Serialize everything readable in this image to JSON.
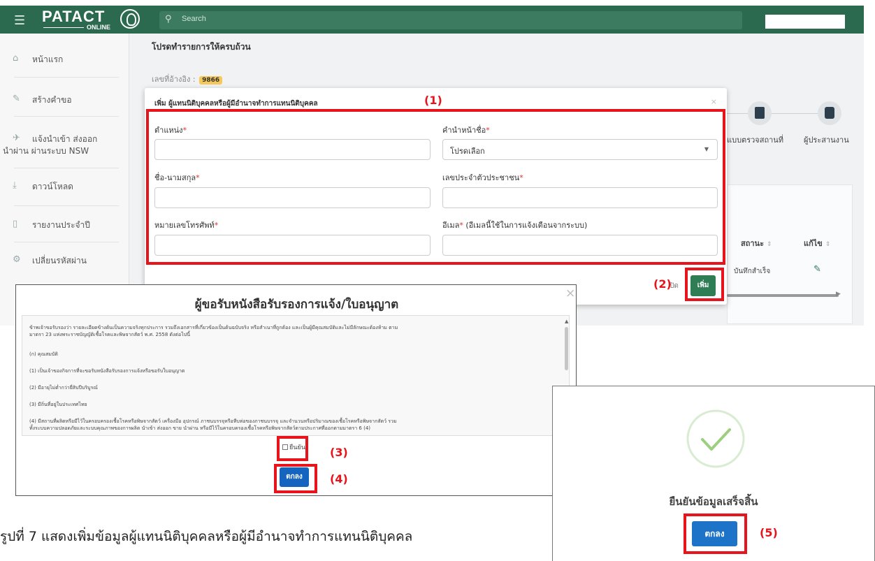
{
  "app": {
    "logo_text": "PATACT",
    "logo_sub": "ONLINE",
    "search_placeholder": "Search"
  },
  "sidebar": {
    "items": [
      {
        "label": "หน้าแรก"
      },
      {
        "label": "สร้างคำขอ"
      },
      {
        "label": "แจ้งนำเข้า ส่งออก"
      },
      {
        "label": "นำผ่าน ผ่านระบบ NSW"
      },
      {
        "label": "ดาวน์โหลด"
      },
      {
        "label": "รายงานประจำปี"
      },
      {
        "label": "เปลี่ยนรหัสผ่าน"
      }
    ]
  },
  "content": {
    "title": "โปรดทำรายการให้ครบถ้วน",
    "ref_label": "เลขที่อ้างอิง :",
    "ref_no": "9866",
    "steps": [
      "แบบตรวจสถานที่",
      "ผู้ประสานงาน"
    ],
    "table_headers": [
      "สถานะ",
      "แก้ไข"
    ],
    "row_status": "บันทึกสำเร็จ"
  },
  "modal1": {
    "title": "เพิ่ม ผู้แทนนิติบุคคลหรือผู้มีอำนาจทำการแทนนิติบุคคล",
    "close": "×",
    "fields": {
      "position": "ตำแหน่ง",
      "prefix": "คำนำหน้าชื่อ",
      "prefix_value": "โปรดเลือก",
      "fullname": "ชื่อ-นามสกุล",
      "id_card": "เลขประจำตัวประชาชน",
      "phone": "หมายเลขโทรศัพท์",
      "email": "อีเมล",
      "email_note": " (อีเมลนี้ใช้ในการแจ้งเตือนจากระบบ)",
      "required_mark": "*"
    },
    "close_button": "ปิด",
    "add_button": "เพิ่ม"
  },
  "dialog2": {
    "title": "ผู้ขอรับหนังสือรับรองการแจ้ง/ใบอนุญาต",
    "close": "×",
    "paragraphs": [
      "ข้าพเจ้าขอรับรองว่า รายละเอียดข้างต้นเป็นความจริงทุกประการ รวมถึงเอกสารที่เกี่ยวข้องเป็นต้นฉบับจริง หรือสำเนาที่ถูกต้อง และเป็นผู้มีคุณสมบัติและไม่มีลักษณะต้องห้าม ตาม",
      "มาตรา 23 แห่งพระราชบัญญัติเชื้อโรคและพิษจากสัตว์ พ.ศ. 2558 ดังต่อไปนี้",
      "(ก) คุณสมบัติ",
      "(1) เป็นเจ้าของกิจการที่จะขอรับหนังสือรับรองการแจ้งหรือขอรับใบอนุญาต",
      "(2) มีอายุไม่ต่ำกว่ายี่สิบปีบริบูรณ์",
      "(3) มีถิ่นที่อยู่ในประเทศไทย",
      "(4) มีสถานที่ผลิตหรือมีไว้ในครอบครองเชื้อโรคหรือพิษจากสัตว์ เครื่องมือ อุปกรณ์ ภาชนบรรจุหรือหีบห่อของภาชนบรรจุ และจำนวนหรือปริมาณของเชื้อโรคหรือพิษจากสัตว์ รวม",
      "ทั้งระบบความปลอดภัยและระบบคุณภาพของการผลิต นำเข้า ส่งออก ขาย นำผ่าน หรือมีไว้ในครอบครองเชื้อโรคหรือพิษจากสัตว์ตามประกาศที่ออกตามมาตรา 6 (4)"
    ],
    "confirm_label": "ยืนยัน",
    "ok_button": "ตกลง"
  },
  "dialog3": {
    "message": "ยืนยันข้อมูลเสร็จสิ้น",
    "ok_button": "ตกลง"
  },
  "callouts": [
    "(1)",
    "(2)",
    "(3)",
    "(4)",
    "(5)"
  ],
  "caption": "รูปที่ 7 แสดงเพิ่มข้อมูลผู้แทนนิติบุคคลหรือผู้มีอำนาจทำการแทนนิติบุคคล",
  "colors": {
    "brand_green": "#2b6a4f",
    "highlight_red": "#e8141c",
    "primary_blue": "#1565c0",
    "success_green": "#2e7d55"
  }
}
